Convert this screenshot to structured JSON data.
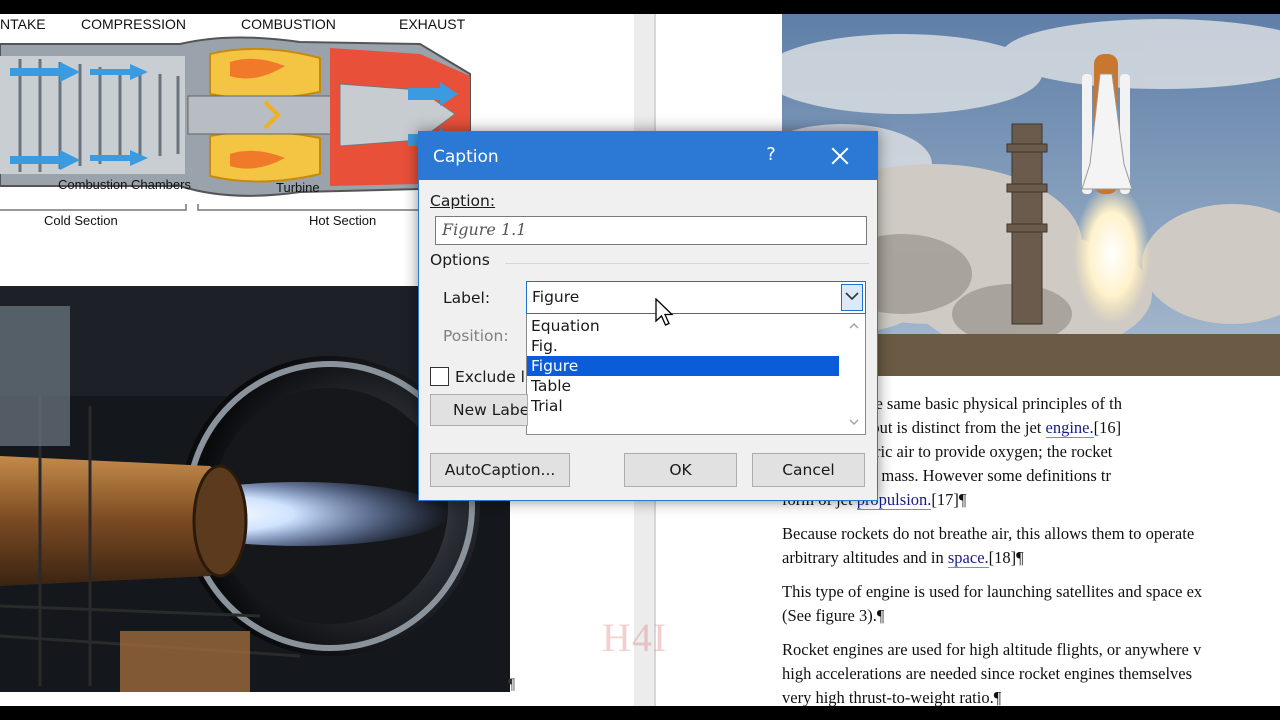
{
  "engine_diagram": {
    "labels": {
      "intake": "NTAKE",
      "compression": "COMPRESSION",
      "combustion": "COMBUSTION",
      "exhaust": "EXHAUST",
      "combustion_chambers": "Combustion Chambers",
      "turbine": "Turbine",
      "cold_section": "Cold Section",
      "hot_section": "Hot Section"
    }
  },
  "document": {
    "right_paragraphs": [
      {
        "lines": [
          {
            "text": "engine uses the same basic physical principles of th"
          },
          {
            "text": "ction engine, but is distinct from the jet ",
            "link": "engine.",
            "tail": "[16]"
          },
          {
            "text": "uire atmospheric air to provide oxygen; the rocket"
          },
          {
            "text": "of the reaction mass. However some definitions tr"
          },
          {
            "text": "form of jet ",
            "link": "propulsion.",
            "tail": "[17]¶"
          }
        ]
      },
      {
        "lines": [
          {
            "text": "Because rockets do not breathe air, this allows them to operate"
          },
          {
            "text": "arbitrary altitudes and in ",
            "link": "space.",
            "tail": "[18]¶"
          }
        ]
      },
      {
        "lines": [
          {
            "text": "This type of engine is used for launching satellites and space ex"
          },
          {
            "text": "(See figure 3).¶"
          }
        ]
      },
      {
        "lines": [
          {
            "text": "Rocket engines are used for high altitude flights, or anywhere v"
          },
          {
            "text": "high accelerations are needed since rocket engines themselves"
          },
          {
            "text": "very high thrust-to-weight ratio.¶"
          }
        ]
      }
    ],
    "left_pilcrow": "¶",
    "watermark": "H4I"
  },
  "dialog": {
    "title": "Caption",
    "help_label": "?",
    "caption_label": "Caption:",
    "caption_value": "Figure 1.1",
    "options_label": "Options",
    "label_label": "Label:",
    "label_value": "Figure",
    "label_options": [
      "Equation",
      "Fig.",
      "Figure",
      "Table",
      "Trial"
    ],
    "selected_option": "Figure",
    "position_label": "Position:",
    "exclude_label": "Exclude l",
    "exclude_checked": false,
    "new_label_button": "New Label",
    "autocaption_button": "AutoCaption...",
    "ok_button": "OK",
    "cancel_button": "Cancel"
  },
  "colors": {
    "titlebar": "#2b79d5",
    "selection": "#0a5cd8",
    "dialog_bg": "#f0f0f0"
  }
}
